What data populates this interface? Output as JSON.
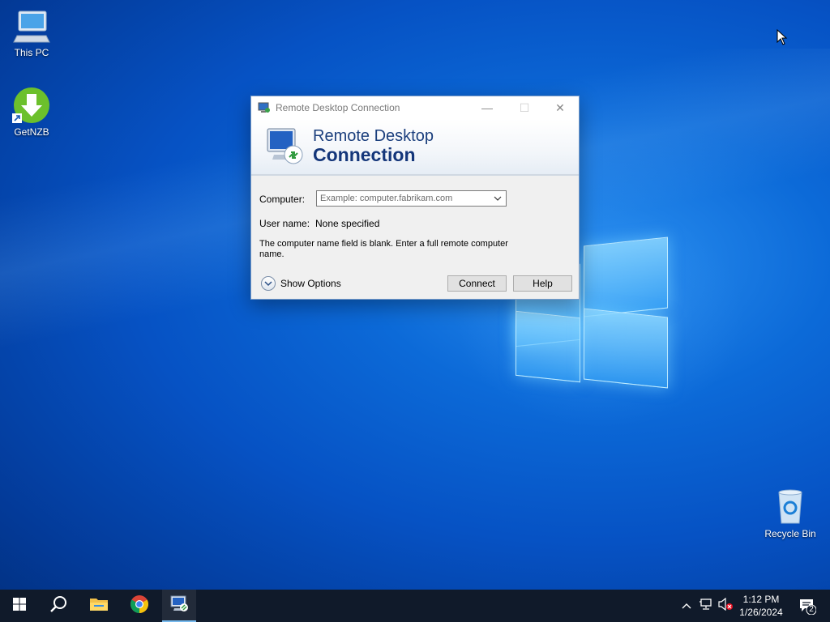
{
  "desktop": {
    "icons": [
      {
        "label": "This PC"
      },
      {
        "label": "GetNZB"
      },
      {
        "label": "Recycle Bin"
      }
    ]
  },
  "dialog": {
    "title": "Remote Desktop Connection",
    "banner_line1": "Remote Desktop",
    "banner_line2": "Connection",
    "computer_label": "Computer:",
    "computer_placeholder": "Example: computer.fabrikam.com",
    "username_label": "User name:",
    "username_value": "None specified",
    "message": "The computer name field is blank. Enter a full remote computer name.",
    "show_options_label": "Show Options",
    "connect_label": "Connect",
    "help_label": "Help"
  },
  "taskbar": {
    "time": "1:12 PM",
    "date": "1/26/2024",
    "notification_count": "2",
    "pinned": [
      "start-icon",
      "search-icon",
      "file-explorer-icon",
      "chrome-icon",
      "remote-desktop-icon"
    ]
  },
  "colors": {
    "banner_text": "#14367a",
    "taskbar_bg": "#101a2a",
    "desktop_accent": "#0c6ad8"
  }
}
